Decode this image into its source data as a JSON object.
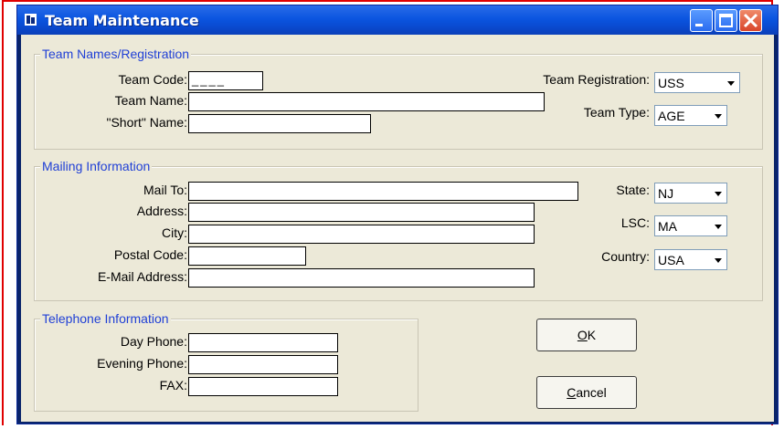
{
  "window": {
    "title": "Team Maintenance"
  },
  "team": {
    "legend": "Team Names/Registration",
    "code_label": "Team Code:",
    "code_value": "____",
    "name_label": "Team Name:",
    "name_value": "",
    "short_label": "\"Short\" Name:",
    "short_value": "",
    "registration_label": "Team Registration:",
    "registration_value": "USS",
    "type_label": "Team Type:",
    "type_value": "AGE"
  },
  "mailing": {
    "legend": "Mailing Information",
    "mailto_label": "Mail To:",
    "mailto_value": "",
    "address_label": "Address:",
    "address_value": "",
    "city_label": "City:",
    "city_value": "",
    "postal_label": "Postal Code:",
    "postal_value": "",
    "email_label": "E-Mail Address:",
    "email_value": "",
    "state_label": "State:",
    "state_value": "NJ",
    "lsc_label": "LSC:",
    "lsc_value": "MA",
    "country_label": "Country:",
    "country_value": "USA"
  },
  "phone": {
    "legend": "Telephone Information",
    "day_label": "Day Phone:",
    "day_value": "",
    "evening_label": "Evening Phone:",
    "evening_value": "",
    "fax_label": "FAX:",
    "fax_value": ""
  },
  "buttons": {
    "ok_accel": "O",
    "ok_rest": "K",
    "cancel_accel": "C",
    "cancel_rest": "ancel"
  },
  "icons": [
    "window-icon",
    "minimize-icon",
    "maximize-icon",
    "close-icon",
    "dropdown-arrow-icon"
  ]
}
